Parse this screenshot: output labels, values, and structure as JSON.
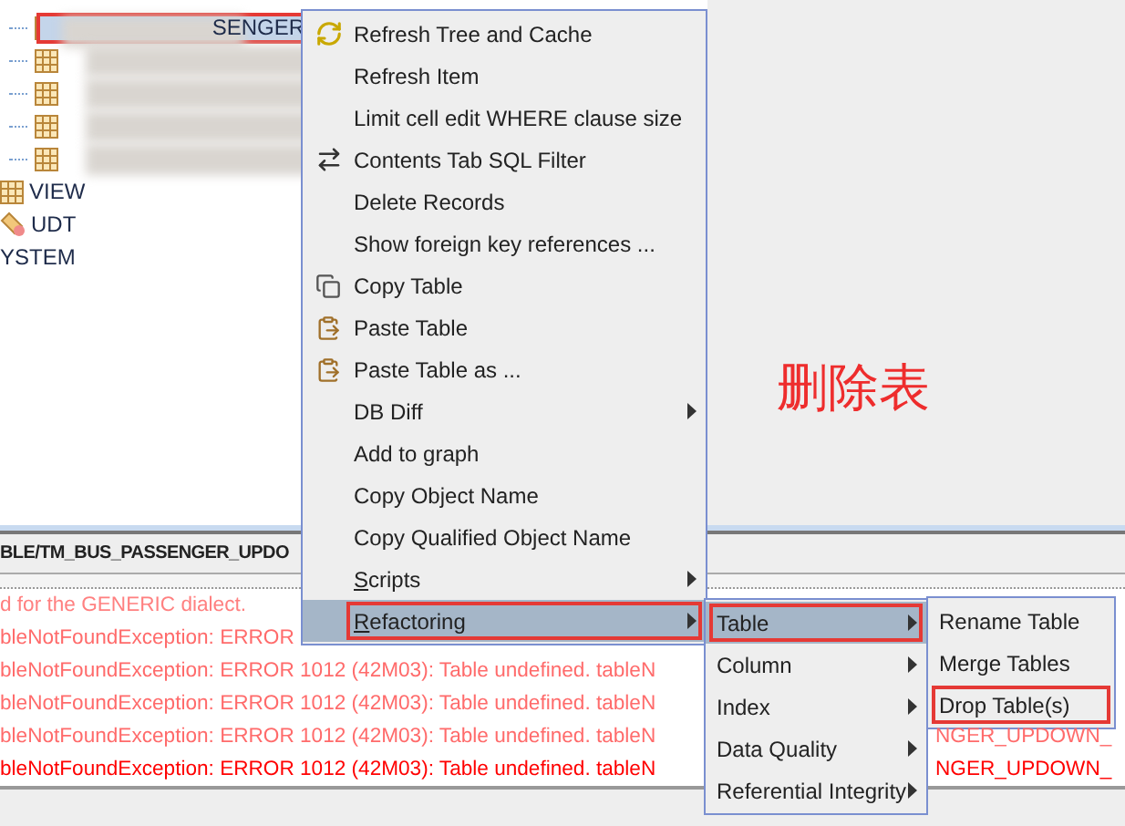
{
  "tree": {
    "items": [
      {
        "kind": "table",
        "label": "SENGER",
        "selected": true,
        "annotated": true,
        "redacted": true
      },
      {
        "kind": "table",
        "selected": false,
        "annotated": false,
        "redacted": true
      },
      {
        "kind": "table",
        "selected": false,
        "annotated": false,
        "redacted": true
      },
      {
        "kind": "table",
        "selected": false,
        "annotated": false,
        "redacted": true
      },
      {
        "kind": "table",
        "selected": false,
        "annotated": false,
        "redacted": true
      },
      {
        "kind": "view",
        "label": "VIEW",
        "selected": false,
        "annotated": false,
        "redacted": false
      },
      {
        "kind": "udt",
        "label": "UDT",
        "selected": false,
        "annotated": false,
        "redacted": false
      },
      {
        "kind": "plain",
        "label": "YSTEM",
        "selected": false,
        "annotated": false,
        "redacted": false
      }
    ]
  },
  "path_bar": {
    "text": "BLE/TM_BUS_PASSENGER_UPDO"
  },
  "log": {
    "lines": [
      {
        "text": "d for the GENERIC dialect.",
        "color": "#ff8080"
      },
      {
        "text": "bleNotFoundException: ERROR",
        "color": "#ff6b6b"
      },
      {
        "text": "bleNotFoundException: ERROR 1012 (42M03): Table undefined. tableN",
        "color": "#ff6b6b"
      },
      {
        "text": "bleNotFoundException: ERROR 1012 (42M03): Table undefined. tableN",
        "color": "#ff6b6b"
      },
      {
        "text": "bleNotFoundException: ERROR 1012 (42M03): Table undefined. tableN",
        "tail": "NGER_UPDOWN_",
        "color": "#ff6b6b"
      },
      {
        "text": "bleNotFoundException: ERROR 1012 (42M03): Table undefined. tableN",
        "tail": "NGER_UPDOWN_",
        "color": "#ff0000"
      }
    ]
  },
  "annotation": {
    "text": "删除表"
  },
  "context_menu": {
    "items": [
      {
        "label": "Refresh Tree and Cache",
        "kind": "refresh",
        "submenu": false,
        "selected": false,
        "annotated": false,
        "mnemonic": false
      },
      {
        "label": "Refresh Item",
        "kind": "plain",
        "submenu": false,
        "selected": false,
        "annotated": false,
        "mnemonic": false
      },
      {
        "label": "Limit cell edit WHERE clause size",
        "kind": "plain",
        "submenu": false,
        "selected": false,
        "annotated": false,
        "mnemonic": false
      },
      {
        "label": "Contents Tab SQL Filter",
        "kind": "filter",
        "submenu": false,
        "selected": false,
        "annotated": false,
        "mnemonic": false
      },
      {
        "label": "Delete Records",
        "kind": "plain",
        "submenu": false,
        "selected": false,
        "annotated": false,
        "mnemonic": false
      },
      {
        "label": "Show foreign key references ...",
        "kind": "plain",
        "submenu": false,
        "selected": false,
        "annotated": false,
        "mnemonic": false
      },
      {
        "label": "Copy Table",
        "kind": "copy",
        "submenu": false,
        "selected": false,
        "annotated": false,
        "mnemonic": false
      },
      {
        "label": "Paste Table",
        "kind": "paste",
        "submenu": false,
        "selected": false,
        "annotated": false,
        "mnemonic": false
      },
      {
        "label": "Paste Table as ...",
        "kind": "paste",
        "submenu": false,
        "selected": false,
        "annotated": false,
        "mnemonic": false
      },
      {
        "label": "DB Diff",
        "kind": "plain",
        "submenu": true,
        "selected": false,
        "annotated": false,
        "mnemonic": false
      },
      {
        "label": "Add to graph",
        "kind": "plain",
        "submenu": false,
        "selected": false,
        "annotated": false,
        "mnemonic": false
      },
      {
        "label": "Copy Object Name",
        "kind": "plain",
        "submenu": false,
        "selected": false,
        "annotated": false,
        "mnemonic": false
      },
      {
        "label": "Copy Qualified Object Name",
        "kind": "plain",
        "submenu": false,
        "selected": false,
        "annotated": false,
        "mnemonic": false
      },
      {
        "label": "Scripts",
        "kind": "plain",
        "submenu": true,
        "selected": false,
        "annotated": false,
        "mnemonic": true
      },
      {
        "label": "Refactoring",
        "kind": "plain",
        "submenu": true,
        "selected": true,
        "annotated": true,
        "mnemonic": true
      }
    ]
  },
  "refactoring_menu": {
    "items": [
      {
        "label": "Table",
        "submenu": true,
        "selected": true,
        "annotated": true,
        "mnemonic": false
      },
      {
        "label": "Column",
        "submenu": true,
        "selected": false,
        "annotated": false,
        "mnemonic": false
      },
      {
        "label": "Index",
        "submenu": true,
        "selected": false,
        "annotated": false,
        "mnemonic": false
      },
      {
        "label": "Data Quality",
        "submenu": true,
        "selected": false,
        "annotated": false,
        "mnemonic": false
      },
      {
        "label": "Referential Integrity",
        "submenu": true,
        "selected": false,
        "annotated": false,
        "mnemonic": false
      }
    ]
  },
  "table_menu": {
    "items": [
      {
        "label": "Rename Table",
        "submenu": false,
        "selected": false,
        "annotated": false,
        "mnemonic": false
      },
      {
        "label": "Merge Tables",
        "submenu": false,
        "selected": false,
        "annotated": false,
        "mnemonic": false
      },
      {
        "label": "Drop Table(s)",
        "submenu": false,
        "selected": false,
        "annotated": true,
        "mnemonic": false
      }
    ]
  }
}
